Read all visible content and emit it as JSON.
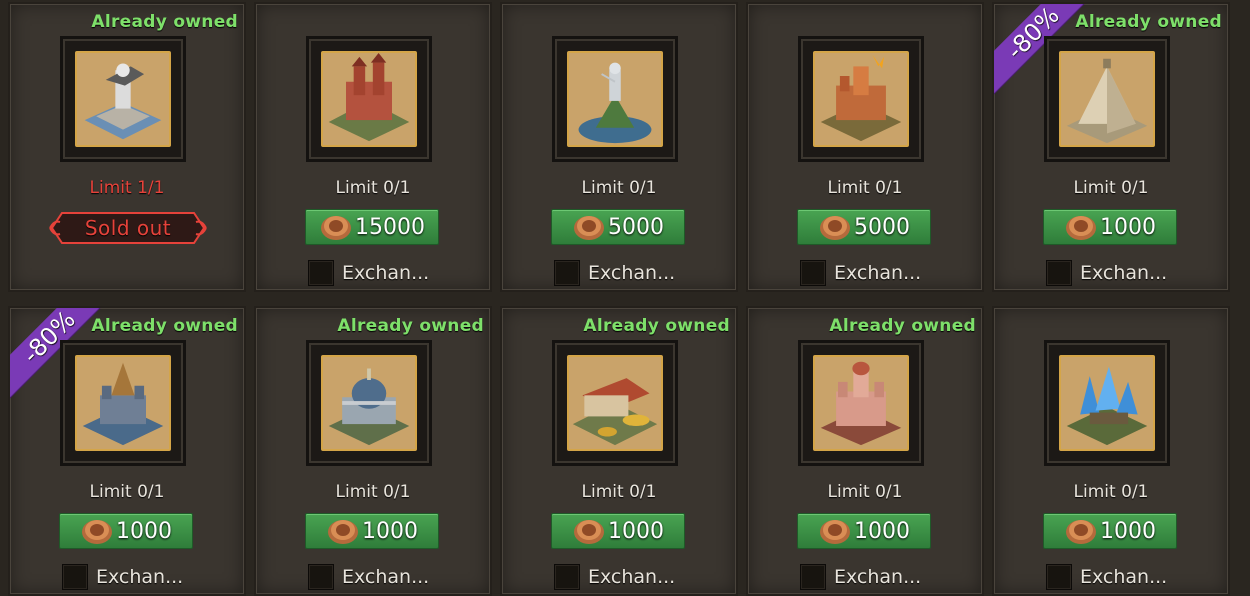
{
  "accent": {
    "green": "#3f9a4a",
    "owned": "#7ee06a",
    "limit_red": "#e6423a",
    "ribbon": "#7a3ab6",
    "gold": "#d4a548"
  },
  "icons": {
    "currency": "bronze-coin-icon",
    "checkbox": "checkbox-icon"
  },
  "items": [
    {
      "owned": "Already owned",
      "limit": "Limit 1/1",
      "sold": "Sold out",
      "price": null,
      "exchange": null,
      "discount": null,
      "art": "statue-fort-skin"
    },
    {
      "owned": null,
      "limit": "Limit 0/1",
      "price": "15000",
      "exchange": "Exchan...",
      "discount": null,
      "art": "red-castle-skin"
    },
    {
      "owned": null,
      "limit": "Limit 0/1",
      "price": "5000",
      "exchange": "Exchan...",
      "discount": null,
      "art": "knight-statue-skin"
    },
    {
      "owned": null,
      "limit": "Limit 0/1",
      "price": "5000",
      "exchange": "Exchan...",
      "discount": null,
      "art": "orange-citadel-skin"
    },
    {
      "owned": "Already owned",
      "limit": "Limit 0/1",
      "price": "1000",
      "exchange": "Exchan...",
      "discount": "-80%",
      "art": "sand-pyramid-skin"
    },
    {
      "owned": "Already owned",
      "limit": "Limit 0/1",
      "price": "1000",
      "exchange": "Exchan...",
      "discount": "-80%",
      "art": "golden-fort-skin"
    },
    {
      "owned": "Already owned",
      "limit": "Limit 0/1",
      "price": "1000",
      "exchange": "Exchan...",
      "discount": null,
      "art": "domed-city-skin"
    },
    {
      "owned": "Already owned",
      "limit": "Limit 0/1",
      "price": "1000",
      "exchange": "Exchan...",
      "discount": null,
      "art": "treasury-skin"
    },
    {
      "owned": "Already owned",
      "limit": "Limit 0/1",
      "price": "1000",
      "exchange": "Exchan...",
      "discount": null,
      "art": "pink-palace-skin"
    },
    {
      "owned": null,
      "limit": "Limit 0/1",
      "price": "1000",
      "exchange": "Exchan...",
      "discount": null,
      "art": "crystal-mine-skin"
    }
  ]
}
